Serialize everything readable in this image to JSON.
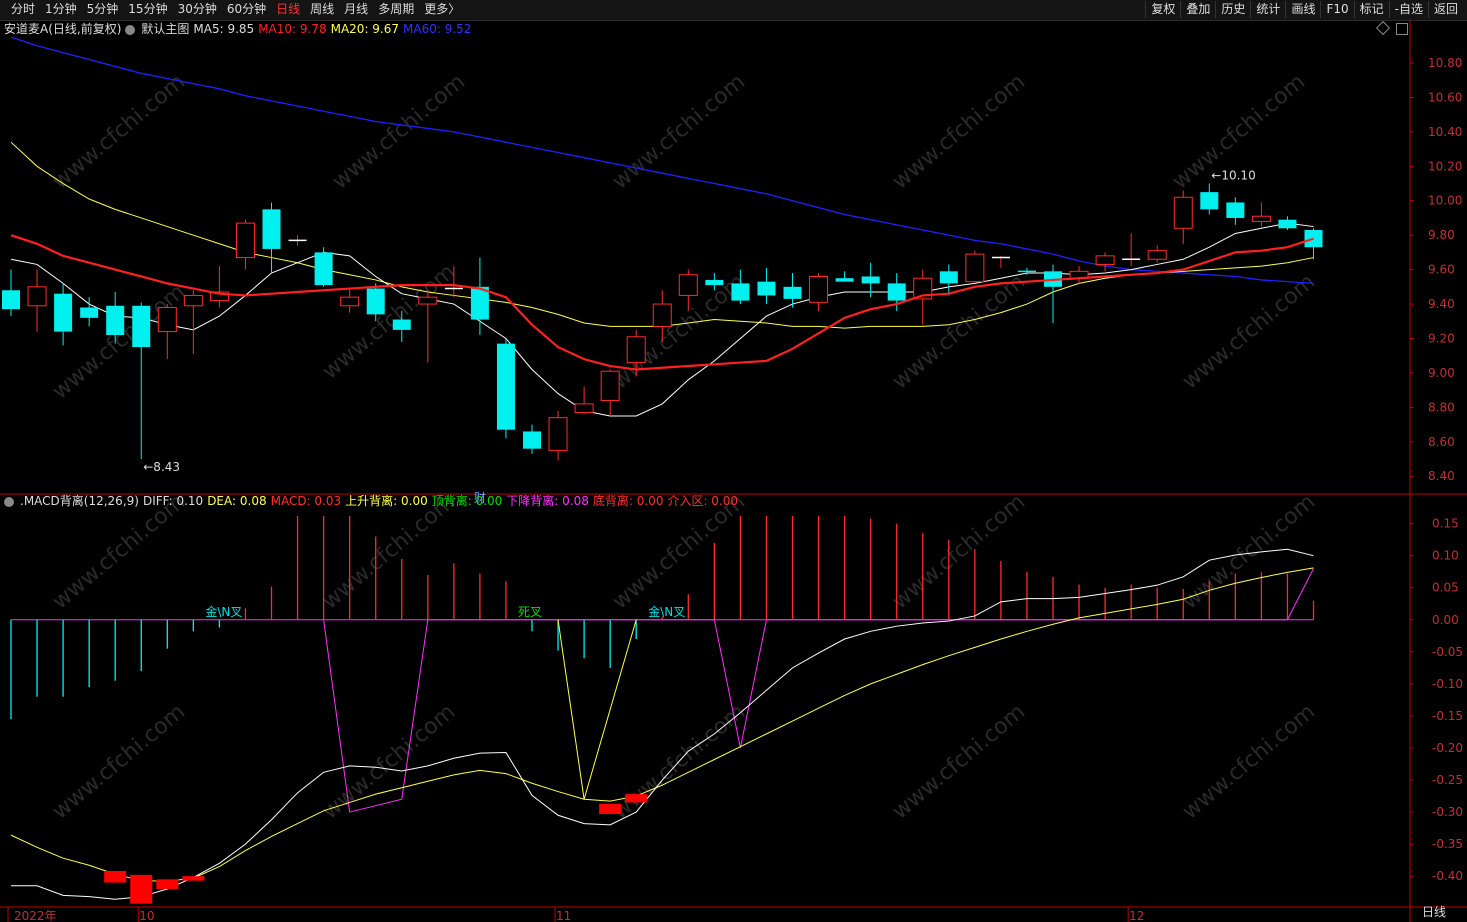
{
  "toolbar": {
    "periods": [
      "分时",
      "1分钟",
      "5分钟",
      "15分钟",
      "30分钟",
      "60分钟",
      "日线",
      "周线",
      "月线",
      "多周期",
      "更多〉"
    ],
    "active_period": "日线",
    "actions": [
      "复权",
      "叠加",
      "历史",
      "统计",
      "画线",
      "F10",
      "标记",
      "-自选",
      "返回"
    ]
  },
  "main_legend": {
    "stock": "安道麦A(日线,前复权)",
    "template": "默认主图",
    "ma5": "MA5: 9.85",
    "ma10": "MA10: 9.78",
    "ma20": "MA20: 9.67",
    "ma60": "MA60: 9.52"
  },
  "macd_legend": {
    "name": ".MACD背离(12,26,9)",
    "diff": "DIFF: 0.10",
    "dea": "DEA: 0.08",
    "macd": "MACD: 0.03",
    "up_div": "上升背离: 0.00",
    "top_div": "顶背离: 0.00",
    "down_div": "下降背离: 0.08",
    "bottom_div": "底背离: 0.00",
    "entry": "介入区: 0.00"
  },
  "colors": {
    "up": "#ff2a2a",
    "down": "#00f0f0",
    "ma5": "#ffffff",
    "ma10": "#ff2020",
    "ma20": "#ffff50",
    "ma60": "#2020ff",
    "axis": "#c00000",
    "magenta": "#ff30ff"
  },
  "bottom_period": "日线",
  "watermark": "www.cfchi.com",
  "chart_data": {
    "type": "candlestick",
    "x_labels": [
      {
        "i": 0,
        "label": "2022年"
      },
      {
        "i": 5,
        "label": "10"
      },
      {
        "i": 21,
        "label": "11"
      },
      {
        "i": 43,
        "label": "12"
      }
    ],
    "price_ticks": [
      8.4,
      8.6,
      8.8,
      9.0,
      9.2,
      9.4,
      9.6,
      9.8,
      10.0,
      10.2,
      10.4,
      10.6,
      10.8
    ],
    "ylim": [
      8.32,
      10.98
    ],
    "annotations": [
      {
        "i": 5,
        "text": "←8.43",
        "price": 8.43
      },
      {
        "i": 46,
        "text": "←10.10",
        "price": 10.1
      },
      {
        "i": 18,
        "text": "财"
      }
    ],
    "candles": [
      [
        9.48,
        9.37,
        9.6,
        9.33
      ],
      [
        9.39,
        9.5,
        9.6,
        9.24
      ],
      [
        9.46,
        9.24,
        9.52,
        9.16
      ],
      [
        9.38,
        9.32,
        9.44,
        9.27
      ],
      [
        9.39,
        9.22,
        9.47,
        9.17
      ],
      [
        9.39,
        9.15,
        9.41,
        8.5
      ],
      [
        9.24,
        9.38,
        9.4,
        9.08
      ],
      [
        9.39,
        9.45,
        9.48,
        9.11
      ],
      [
        9.42,
        9.47,
        9.62,
        9.38
      ],
      [
        9.67,
        9.87,
        9.89,
        9.6
      ],
      [
        9.95,
        9.72,
        9.99,
        9.58
      ],
      [
        9.76,
        9.77,
        9.8,
        9.74
      ],
      [
        9.7,
        9.51,
        9.73,
        9.5
      ],
      [
        9.39,
        9.44,
        9.49,
        9.35
      ],
      [
        9.49,
        9.34,
        9.52,
        9.3
      ],
      [
        9.31,
        9.25,
        9.36,
        9.18
      ],
      [
        9.4,
        9.44,
        9.48,
        9.06
      ],
      [
        9.48,
        9.49,
        9.62,
        9.44
      ],
      [
        9.5,
        9.31,
        9.67,
        9.22
      ],
      [
        9.17,
        8.67,
        9.2,
        8.62
      ],
      [
        8.66,
        8.56,
        8.7,
        8.53
      ],
      [
        8.55,
        8.74,
        8.78,
        8.49
      ],
      [
        8.77,
        8.82,
        8.92,
        8.76
      ],
      [
        8.84,
        9.01,
        9.02,
        8.75
      ],
      [
        9.06,
        9.21,
        9.25,
        8.98
      ],
      [
        9.27,
        9.4,
        9.48,
        9.18
      ],
      [
        9.45,
        9.57,
        9.6,
        9.36
      ],
      [
        9.54,
        9.51,
        9.58,
        9.48
      ],
      [
        9.52,
        9.42,
        9.6,
        9.4
      ],
      [
        9.53,
        9.45,
        9.61,
        9.4
      ],
      [
        9.5,
        9.43,
        9.58,
        9.38
      ],
      [
        9.41,
        9.56,
        9.58,
        9.36
      ],
      [
        9.55,
        9.53,
        9.59,
        9.53
      ],
      [
        9.56,
        9.52,
        9.64,
        9.44
      ],
      [
        9.52,
        9.42,
        9.58,
        9.36
      ],
      [
        9.43,
        9.55,
        9.6,
        9.28
      ],
      [
        9.59,
        9.52,
        9.63,
        9.45
      ],
      [
        9.53,
        9.69,
        9.71,
        9.53
      ],
      [
        9.66,
        9.67,
        9.68,
        9.61
      ],
      [
        9.59,
        9.58,
        9.61,
        9.57
      ],
      [
        9.59,
        9.5,
        9.63,
        9.29
      ],
      [
        9.55,
        9.59,
        9.62,
        9.52
      ],
      [
        9.63,
        9.68,
        9.7,
        9.59
      ],
      [
        9.65,
        9.66,
        9.81,
        9.62
      ],
      [
        9.66,
        9.71,
        9.74,
        9.64
      ],
      [
        9.84,
        10.02,
        10.06,
        9.75
      ],
      [
        10.05,
        9.95,
        10.1,
        9.92
      ],
      [
        9.99,
        9.9,
        10.02,
        9.86
      ],
      [
        9.88,
        9.91,
        9.99,
        9.85
      ],
      [
        9.89,
        9.84,
        9.91,
        9.83
      ],
      [
        9.83,
        9.73,
        9.84,
        9.66
      ]
    ],
    "ma5": [
      9.66,
      9.63,
      9.52,
      9.4,
      9.33,
      9.32,
      9.28,
      9.25,
      9.33,
      9.45,
      9.58,
      9.64,
      9.7,
      9.68,
      9.56,
      9.46,
      9.43,
      9.4,
      9.3,
      9.2,
      9.02,
      8.88,
      8.78,
      8.75,
      8.75,
      8.82,
      8.96,
      9.07,
      9.2,
      9.33,
      9.4,
      9.44,
      9.47,
      9.47,
      9.47,
      9.47,
      9.5,
      9.52,
      9.55,
      9.58,
      9.58,
      9.57,
      9.58,
      9.6,
      9.63,
      9.66,
      9.73,
      9.81,
      9.84,
      9.87,
      9.85
    ],
    "ma10": [
      9.8,
      9.75,
      9.68,
      9.64,
      9.6,
      9.56,
      9.52,
      9.49,
      9.46,
      9.45,
      9.46,
      9.47,
      9.48,
      9.49,
      9.5,
      9.51,
      9.51,
      9.51,
      9.49,
      9.44,
      9.28,
      9.15,
      9.08,
      9.04,
      9.02,
      9.03,
      9.04,
      9.05,
      9.06,
      9.07,
      9.14,
      9.23,
      9.32,
      9.37,
      9.4,
      9.45,
      9.46,
      9.5,
      9.52,
      9.53,
      9.54,
      9.55,
      9.56,
      9.57,
      9.58,
      9.6,
      9.65,
      9.7,
      9.71,
      9.73,
      9.78
    ],
    "ma20": [
      10.34,
      10.2,
      10.1,
      10.01,
      9.95,
      9.9,
      9.85,
      9.8,
      9.75,
      9.7,
      9.67,
      9.64,
      9.6,
      9.57,
      9.54,
      9.5,
      9.47,
      9.45,
      9.43,
      9.41,
      9.38,
      9.34,
      9.29,
      9.27,
      9.27,
      9.27,
      9.29,
      9.31,
      9.3,
      9.29,
      9.27,
      9.27,
      9.26,
      9.27,
      9.27,
      9.27,
      9.28,
      9.31,
      9.35,
      9.4,
      9.47,
      9.52,
      9.55,
      9.57,
      9.58,
      9.59,
      9.6,
      9.61,
      9.62,
      9.64,
      9.67
    ],
    "ma60": [
      10.95,
      10.9,
      10.86,
      10.82,
      10.78,
      10.74,
      10.71,
      10.68,
      10.65,
      10.61,
      10.58,
      10.55,
      10.52,
      10.49,
      10.46,
      10.44,
      10.42,
      10.4,
      10.37,
      10.34,
      10.31,
      10.28,
      10.25,
      10.22,
      10.19,
      10.16,
      10.13,
      10.1,
      10.07,
      10.04,
      10.0,
      9.96,
      9.92,
      9.89,
      9.86,
      9.83,
      9.8,
      9.77,
      9.75,
      9.72,
      9.69,
      9.65,
      9.62,
      9.6,
      9.59,
      9.58,
      9.57,
      9.56,
      9.54,
      9.53,
      9.52
    ],
    "macd_ticks": [
      0.15,
      0.1,
      0.05,
      0.0,
      -0.05,
      -0.1,
      -0.15,
      -0.2,
      -0.25,
      -0.3,
      -0.35,
      -0.4
    ],
    "macd_ylim": [
      -0.445,
      0.19
    ],
    "diff": [
      -0.415,
      -0.415,
      -0.43,
      -0.432,
      -0.436,
      -0.432,
      -0.42,
      -0.402,
      -0.38,
      -0.35,
      -0.312,
      -0.27,
      -0.238,
      -0.228,
      -0.23,
      -0.236,
      -0.228,
      -0.216,
      -0.208,
      -0.207,
      -0.274,
      -0.305,
      -0.318,
      -0.32,
      -0.3,
      -0.25,
      -0.205,
      -0.178,
      -0.145,
      -0.11,
      -0.075,
      -0.052,
      -0.03,
      -0.018,
      -0.01,
      -0.005,
      -0.002,
      0.006,
      0.028,
      0.033,
      0.033,
      0.035,
      0.041,
      0.047,
      0.054,
      0.067,
      0.093,
      0.101,
      0.106,
      0.11,
      0.1
    ],
    "dea": [
      -0.336,
      -0.355,
      -0.372,
      -0.383,
      -0.397,
      -0.407,
      -0.408,
      -0.403,
      -0.385,
      -0.36,
      -0.338,
      -0.318,
      -0.298,
      -0.285,
      -0.272,
      -0.262,
      -0.252,
      -0.242,
      -0.235,
      -0.24,
      -0.255,
      -0.268,
      -0.28,
      -0.283,
      -0.275,
      -0.258,
      -0.238,
      -0.218,
      -0.198,
      -0.178,
      -0.158,
      -0.138,
      -0.118,
      -0.1,
      -0.085,
      -0.07,
      -0.056,
      -0.043,
      -0.03,
      -0.018,
      -0.007,
      0.003,
      0.01,
      0.017,
      0.024,
      0.032,
      0.046,
      0.057,
      0.066,
      0.074,
      0.081
    ],
    "macd": [
      -0.155,
      -0.12,
      -0.12,
      -0.105,
      -0.095,
      -0.08,
      -0.045,
      -0.018,
      -0.012,
      0.018,
      0.052,
      0.162,
      0.162,
      0.162,
      0.13,
      0.095,
      0.07,
      0.088,
      0.072,
      0.06,
      -0.018,
      -0.048,
      -0.06,
      -0.075,
      -0.03,
      0.005,
      0.04,
      0.12,
      0.162,
      0.162,
      0.162,
      0.162,
      0.162,
      0.158,
      0.15,
      0.135,
      0.125,
      0.11,
      0.092,
      0.075,
      0.067,
      0.055,
      0.05,
      0.055,
      0.05,
      0.048,
      0.06,
      0.072,
      0.075,
      0.072,
      0.03
    ],
    "macd_bars_big": [
      {
        "i": 4,
        "v": -0.41,
        "top": -0.392
      },
      {
        "i": 5,
        "v": -0.443,
        "top": -0.398
      },
      {
        "i": 6,
        "v": -0.42,
        "top": -0.405
      },
      {
        "i": 7,
        "v": -0.407,
        "top": -0.4
      },
      {
        "i": 23,
        "v": -0.303,
        "top": -0.287
      },
      {
        "i": 24,
        "v": -0.285,
        "top": -0.272
      }
    ],
    "cross_labels": [
      {
        "i": 8,
        "text": "金\\N叉",
        "color": "#00e0e0"
      },
      {
        "i": 20,
        "text": "死叉",
        "color": "#00e000"
      },
      {
        "i": 25,
        "text": "金\\N叉",
        "color": "#00e0e0"
      }
    ],
    "magenta_line": [
      [
        12,
        0.0
      ],
      [
        13,
        -0.3
      ],
      [
        15,
        -0.28
      ],
      [
        16,
        0.0
      ],
      [
        27,
        0.0
      ],
      [
        28,
        -0.2
      ],
      [
        29,
        0.0
      ],
      [
        49,
        0.0
      ],
      [
        50,
        0.08
      ]
    ],
    "yellow_line": [
      [
        21,
        0.0
      ],
      [
        22,
        -0.28
      ],
      [
        24,
        0.0
      ]
    ]
  }
}
